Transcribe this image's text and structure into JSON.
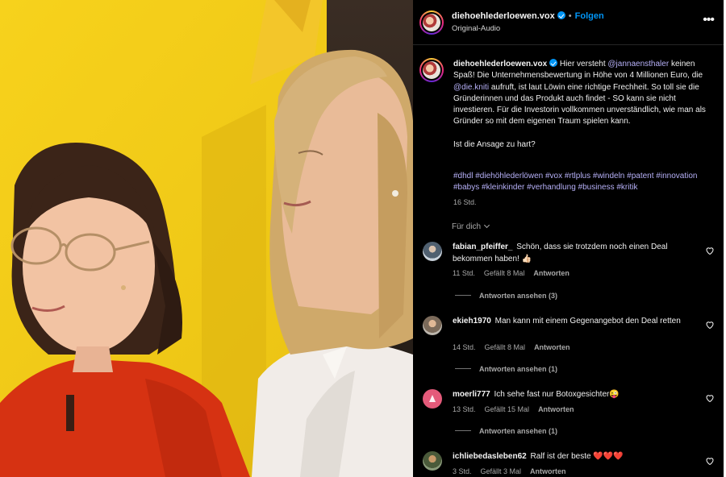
{
  "post": {
    "username": "diehoehlederloewen.vox",
    "follow_label": "Folgen",
    "separator": "•",
    "audio_label": "Original-Audio",
    "more_label": "•••"
  },
  "caption": {
    "username": "diehoehlederloewen.vox",
    "segments": [
      " Hier versteht ",
      "@jannaensthaler",
      " keinen Spaß! Die Unternehmensbewertung in Höhe von 4 Millionen Euro, die ",
      "@die.kniti",
      " aufruft, ist laut Löwin eine richtige Frechheit. So toll sie die Gründerinnen und das Produkt auch findet - SO kann sie nicht investieren. Für die Investorin vollkommen unverständlich, wie man als Gründer so mit dem eigenen Traum spielen kann."
    ],
    "question": "Ist die Ansage zu hart?",
    "hashtags": "#dhdl #diehöhlederlöwen #vox #rtlplus #windeln #patent #innovation #babys #kleinkinder #verhandlung #business #kritik",
    "time": "16 Std."
  },
  "sort": {
    "label": "Für dich"
  },
  "comments": [
    {
      "username": "fabian_pfeiffer_",
      "text": "Schön, dass sie trotzdem noch einen Deal bekommen haben! 👍🏻",
      "time": "11 Std.",
      "likes": "Gefällt 8 Mal",
      "reply": "Antworten",
      "view_replies": "Antworten ansehen (3)"
    },
    {
      "username": "ekieh1970",
      "text": "Man kann mit einem Gegenangebot den Deal retten",
      "time": "14 Std.",
      "likes": "Gefällt 8 Mal",
      "reply": "Antworten",
      "view_replies": "Antworten ansehen (1)"
    },
    {
      "username": "moerli777",
      "text": "Ich sehe fast nur Botoxgesichter😜",
      "time": "13 Std.",
      "likes": "Gefällt 15 Mal",
      "reply": "Antworten",
      "view_replies": "Antworten ansehen (1)"
    },
    {
      "username": "ichliebedasleben62",
      "text": "Ralf ist der beste ❤️❤️❤️",
      "time": "3 Std.",
      "likes": "Gefällt 3 Mal",
      "reply": "Antworten"
    }
  ],
  "colors": {
    "background": "#000000",
    "accent": "#0095f6",
    "mention": "#b6b0f7",
    "muted": "#a8a8a8"
  },
  "icons": [
    "verified-badge-icon",
    "more-options-icon",
    "chevron-down-icon",
    "heart-icon"
  ]
}
